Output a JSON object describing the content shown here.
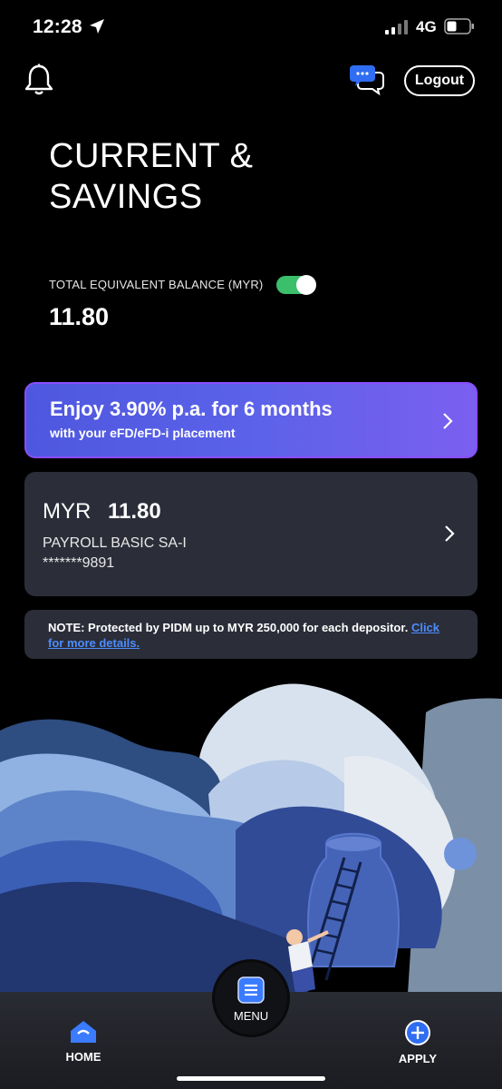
{
  "status_bar": {
    "time": "12:28",
    "network": "4G"
  },
  "header": {
    "logout_label": "Logout"
  },
  "page_title": "CURRENT & SAVINGS",
  "balance": {
    "label": "TOTAL EQUIVALENT BALANCE  (MYR)",
    "value": "11.80",
    "toggle_on": true
  },
  "promo": {
    "title": "Enjoy 3.90% p.a. for 6 months",
    "subtitle": "with your eFD/eFD-i placement"
  },
  "account": {
    "currency": "MYR",
    "amount": "11.80",
    "name": "PAYROLL BASIC SA-I",
    "number": "*******9891"
  },
  "note": {
    "text": "NOTE: Protected by PIDM up to MYR 250,000 for each depositor.",
    "link": "Click for more details."
  },
  "bottom_nav": {
    "home": "HOME",
    "menu": "MENU",
    "apply": "APPLY"
  },
  "colors": {
    "accent_blue": "#3a7bff",
    "toggle_green": "#3bbf6a",
    "promo_border": "#8a4dff",
    "card_bg": "#2b2e38"
  }
}
